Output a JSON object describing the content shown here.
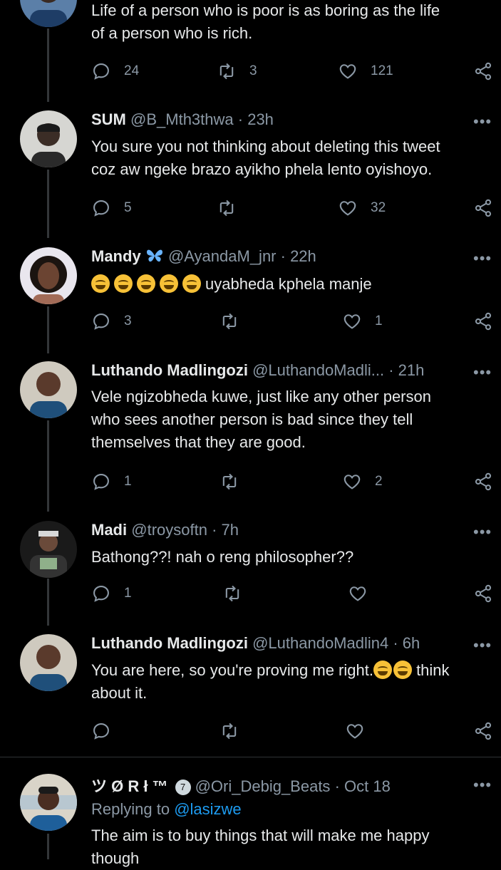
{
  "tweets": [
    {
      "name": "",
      "handle": "",
      "time": "",
      "text_lines": [
        "Life of a person who is poor is as boring as the life",
        "of a person who is rich."
      ],
      "replies": "24",
      "retweets": "3",
      "likes": "121"
    },
    {
      "name": "SUM",
      "handle": "@B_Mth3thwa",
      "time": "· 23h",
      "text_lines": [
        "You sure you not thinking about deleting this tweet",
        "coz aw ngeke brazo ayikho phela lento oyishoyo."
      ],
      "replies": "5",
      "retweets": "",
      "likes": "32"
    },
    {
      "name": "Mandy",
      "handle": "@AyandaM_jnr",
      "time": "· 22h",
      "text": "uyabheda kphela manje",
      "replies": "3",
      "retweets": "",
      "likes": "1"
    },
    {
      "name": "Luthando Madlingozi",
      "handle": "@LuthandoMadli...",
      "time": "· 21h",
      "text_lines": [
        "Vele ngizobheda kuwe, just like any other person",
        "who sees another person is bad since they tell",
        "themselves that they are good."
      ],
      "replies": "1",
      "retweets": "",
      "likes": "2"
    },
    {
      "name": "Madi",
      "handle": "@troysoftn",
      "time": "· 7h",
      "text_lines": [
        "Bathong??! nah o reng philosopher??"
      ],
      "replies": "1",
      "retweets": "",
      "likes": ""
    },
    {
      "name": "Luthando Madlingozi",
      "handle": "@LuthandoMadlin4",
      "time": "· 6h",
      "text_a": "You are here, so you're proving me right.",
      "text_b": " think",
      "text_c": "about it.",
      "replies": "",
      "retweets": "",
      "likes": ""
    },
    {
      "name": "ツ Ø R ł ™",
      "badge": "7",
      "handle": "@Ori_Debig_Beats",
      "time": "· Oct 18",
      "reply_prefix": "Replying to",
      "reply_handle": "@lasizwe",
      "text_lines": [
        "The aim is to buy things that will make me happy",
        "though"
      ]
    }
  ],
  "more_label": "•••",
  "colors": {
    "background": "#000000",
    "text": "#e7e9ea",
    "secondary": "#8b98a5",
    "link": "#1d9bf0"
  }
}
